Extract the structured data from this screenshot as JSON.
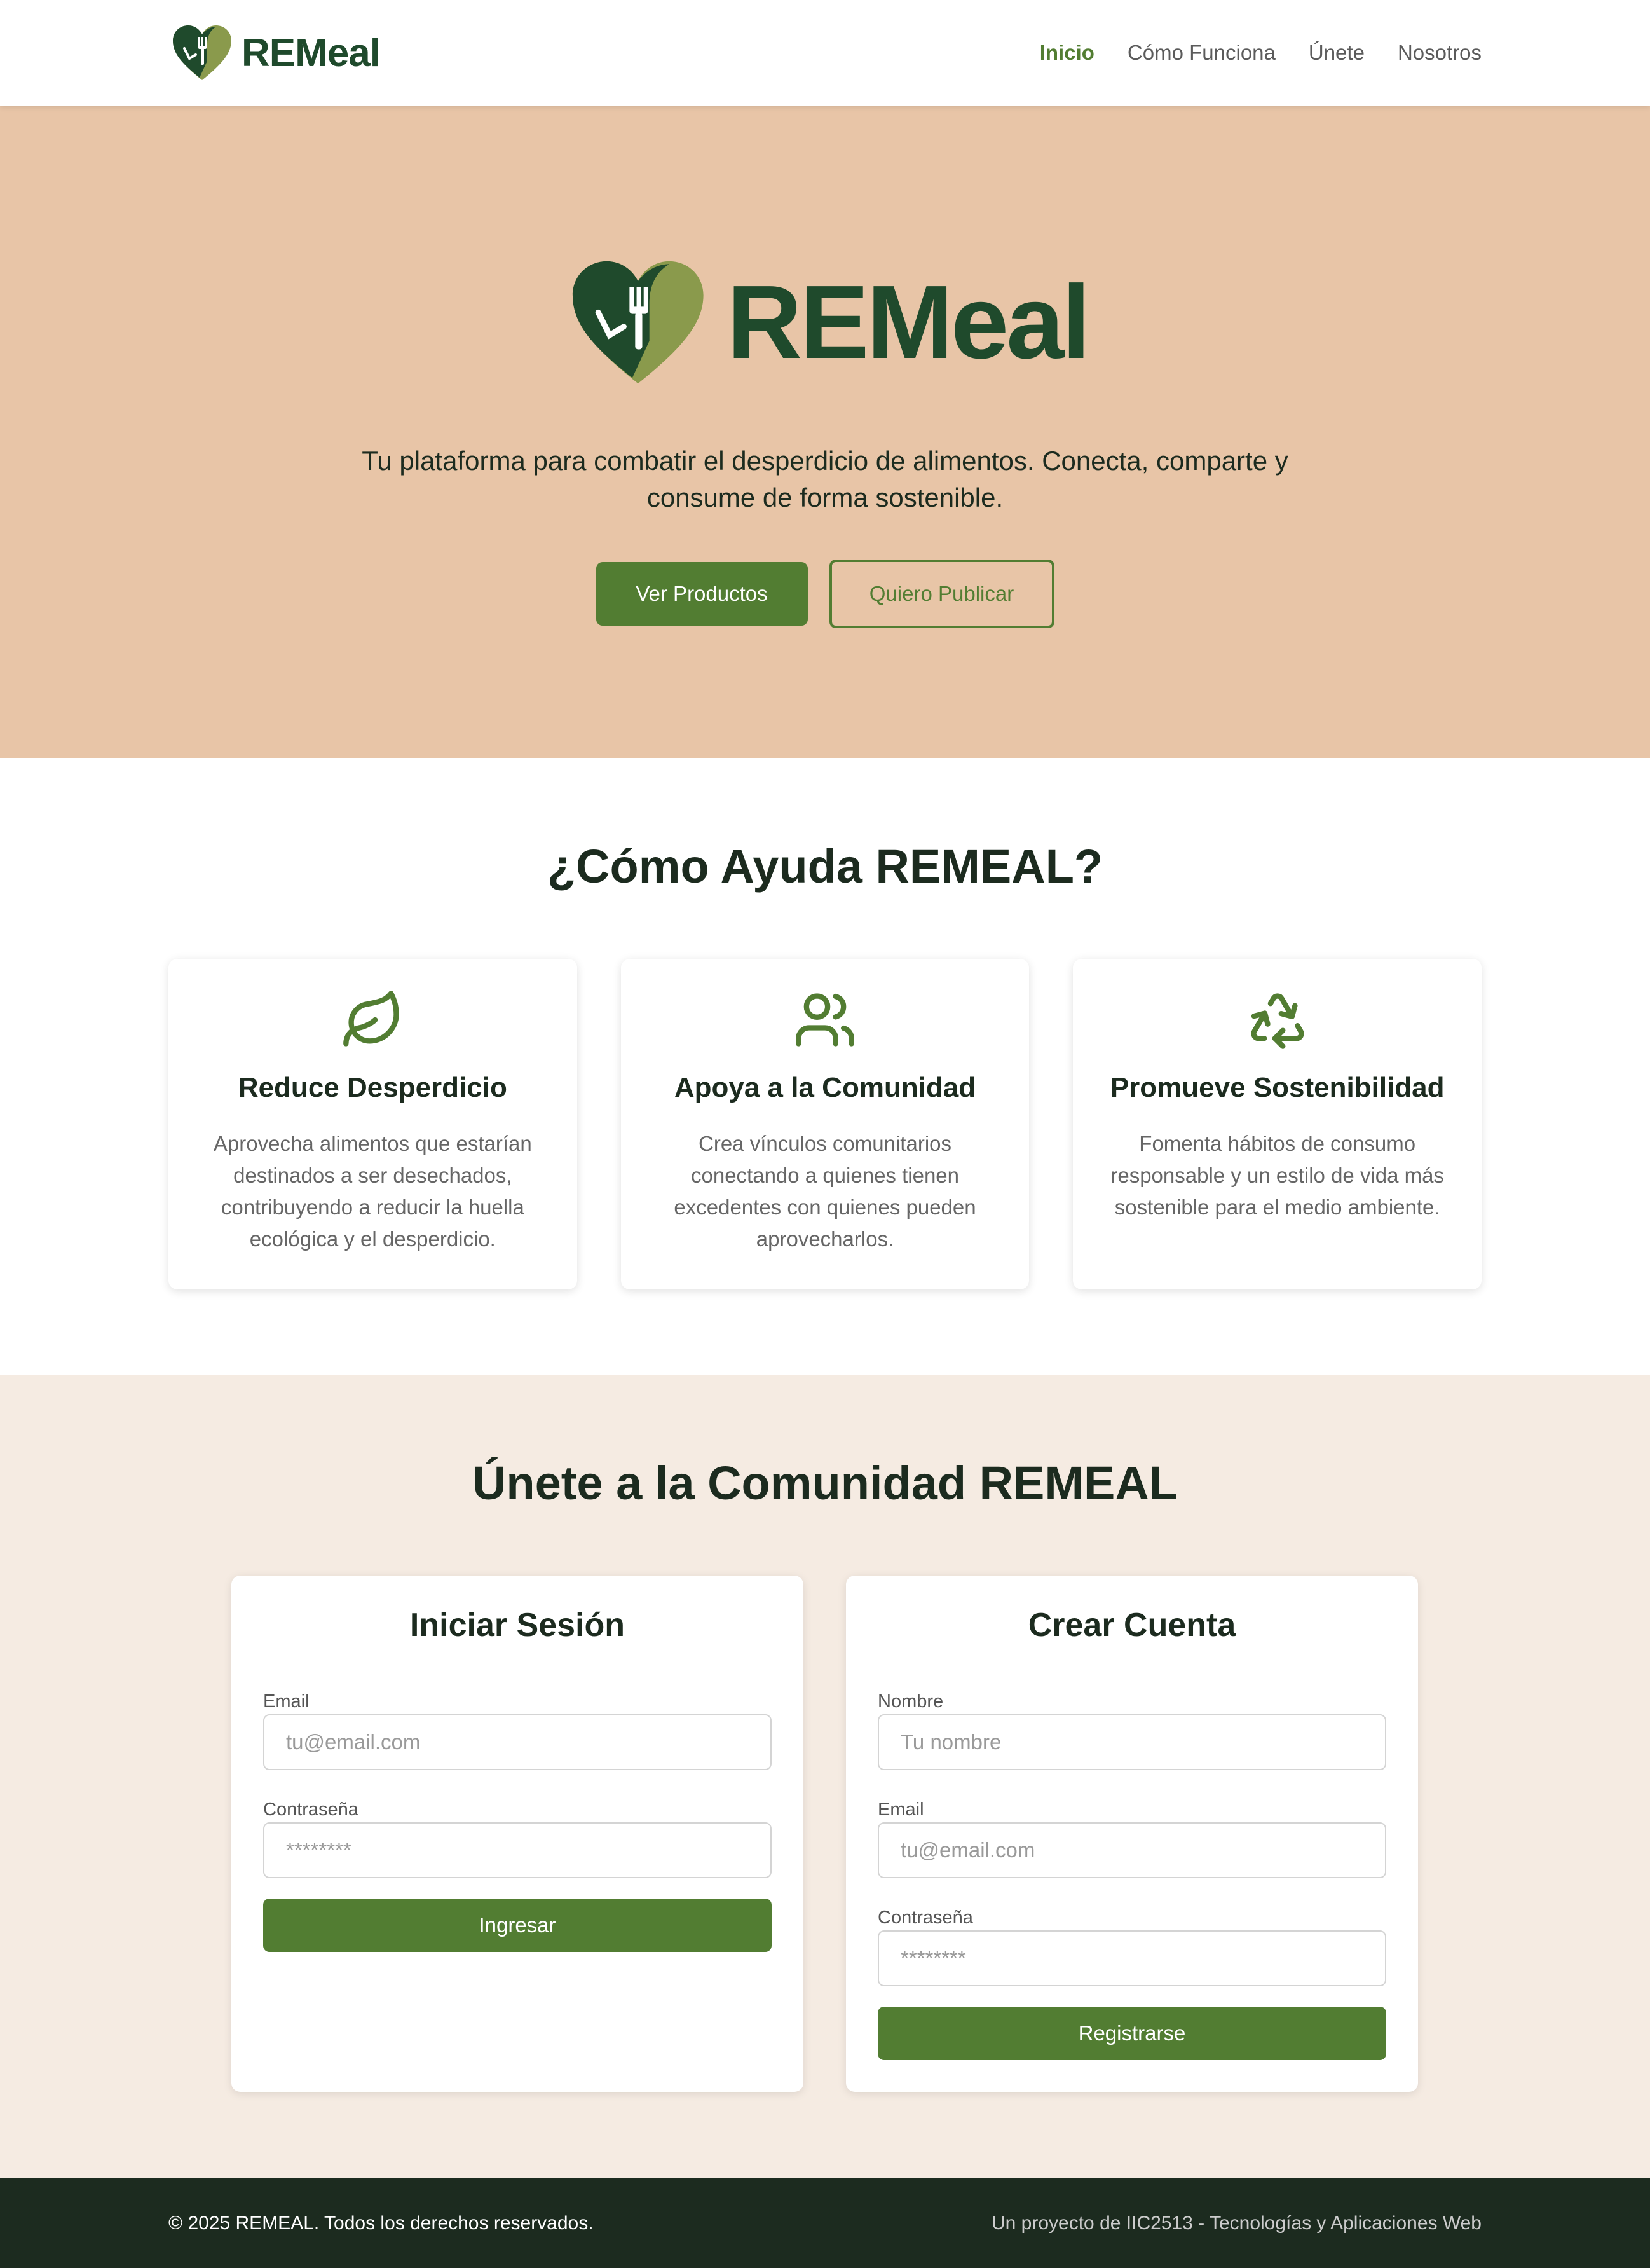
{
  "nav": {
    "logo_text": "REMeal",
    "links": [
      {
        "label": "Inicio",
        "active": true
      },
      {
        "label": "Cómo Funciona",
        "active": false
      },
      {
        "label": "Únete",
        "active": false
      },
      {
        "label": "Nosotros",
        "active": false
      }
    ]
  },
  "hero": {
    "logo_text": "REMeal",
    "tagline": "Tu plataforma para combatir el desperdicio de alimentos. Conecta, comparte y consume de forma sostenible.",
    "primary_button": "Ver Productos",
    "secondary_button": "Quiero Publicar"
  },
  "how": {
    "title": "¿Cómo Ayuda REMEAL?",
    "cards": [
      {
        "icon": "leaf-icon",
        "title": "Reduce Desperdicio",
        "text": "Aprovecha alimentos que estarían destinados a ser desechados, contribuyendo a reducir la huella ecológica y el desperdicio."
      },
      {
        "icon": "users-icon",
        "title": "Apoya a la Comunidad",
        "text": "Crea vínculos comunitarios conectando a quienes tienen excedentes con quienes pueden aprovecharlos."
      },
      {
        "icon": "recycle-icon",
        "title": "Promueve Sostenibilidad",
        "text": "Fomenta hábitos de consumo responsable y un estilo de vida más sostenible para el medio ambiente."
      }
    ]
  },
  "join": {
    "title": "Únete a la Comunidad REMEAL",
    "login": {
      "title": "Iniciar Sesión",
      "email_label": "Email",
      "email_placeholder": "tu@email.com",
      "password_label": "Contraseña",
      "password_placeholder": "********",
      "submit": "Ingresar"
    },
    "register": {
      "title": "Crear Cuenta",
      "name_label": "Nombre",
      "name_placeholder": "Tu nombre",
      "email_label": "Email",
      "email_placeholder": "tu@email.com",
      "password_label": "Contraseña",
      "password_placeholder": "********",
      "submit": "Registrarse"
    }
  },
  "footer": {
    "copyright": "© 2025 REMEAL. Todos los derechos reservados.",
    "credit": "Un proyecto de IIC2513 - Tecnologías y Aplicaciones Web"
  },
  "colors": {
    "brand_green": "#527d32",
    "dark_green": "#1f4a2c",
    "olive": "#8a9a4c",
    "hero_bg": "#e8c5a7",
    "join_bg": "#f5ebe2",
    "footer_bg": "#1c2b1f"
  }
}
